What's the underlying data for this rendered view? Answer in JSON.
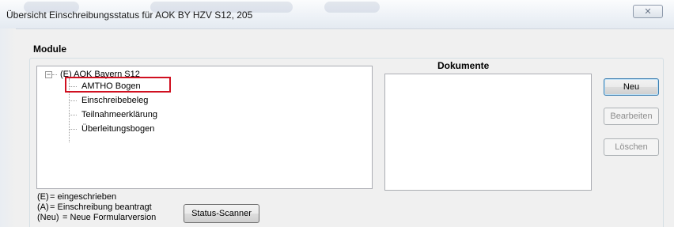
{
  "window": {
    "title": "Übersicht Einschreibungsstatus für AOK BY HZV S12, 205",
    "close_label": "✕"
  },
  "modules": {
    "group_label": "Module",
    "tree": {
      "root": "(E) AOK Bayern S12",
      "children": [
        "AMTHO Bogen",
        "Einschreibebeleg",
        "Teilnahmeerklärung",
        "Überleitungsbogen"
      ],
      "highlighted_child": "AMTHO Bogen"
    }
  },
  "documents": {
    "label": "Dokumente"
  },
  "buttons": {
    "new": "Neu",
    "edit": "Bearbeiten",
    "delete": "Löschen",
    "status_scanner": "Status-Scanner"
  },
  "legend": [
    {
      "key": "(E)",
      "text": "= eingeschrieben"
    },
    {
      "key": "(A)",
      "text": "= Einschreibung beantragt"
    },
    {
      "key": "(Neu)",
      "text": "= Neue Formularversion"
    }
  ],
  "colors": {
    "highlight": "#d01020",
    "button_default_border": "#3c7fb1"
  }
}
